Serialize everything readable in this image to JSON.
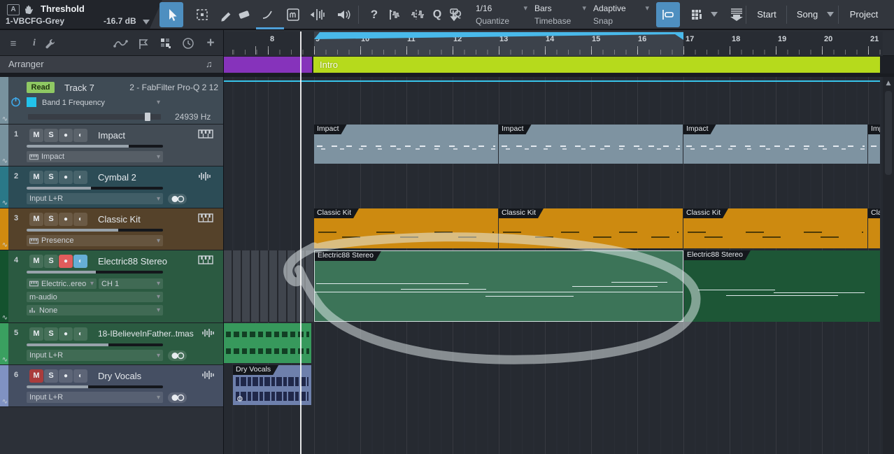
{
  "icons": {
    "chevron": "▾",
    "record": "●",
    "pan": "◐",
    "note": "♫",
    "gear": "⚙",
    "sine": "∿",
    "plus": "+",
    "info": "i",
    "question": "?",
    "menu": "≡",
    "q_tool": "Q",
    "m_tool": "m",
    "a_badge": "A",
    "iq": "IQ",
    "scroll_up": "▲"
  },
  "toolbar": {
    "preset_name": "Threshold",
    "preset_variant": "1-VBCFG-Grey",
    "threshold_value": "-16.7 dB",
    "quantize": {
      "value": "1/16",
      "label": "Quantize"
    },
    "timebase": {
      "value": "Bars",
      "label": "Timebase"
    },
    "snap": {
      "value": "Adaptive",
      "label": "Snap"
    },
    "pages": {
      "start": "Start",
      "song": "Song",
      "project": "Project"
    }
  },
  "panel": {
    "arranger_label": "Arranger"
  },
  "ruler": {
    "bars": [
      "8",
      "9",
      "10",
      "11",
      "12",
      "13",
      "14",
      "15",
      "16",
      "17",
      "18",
      "19",
      "20",
      "21"
    ]
  },
  "arranger": {
    "section_name": "Intro"
  },
  "automation_track": {
    "read_badge": "Read",
    "name": "Track 7",
    "plugin": "2 - FabFilter Pro-Q 2 12",
    "parameter": "Band 1 Frequency",
    "value": "24939 Hz"
  },
  "labels": {
    "mute": "M",
    "solo": "S"
  },
  "tracks": [
    {
      "num": "1",
      "name": "Impact",
      "io": "Impact"
    },
    {
      "num": "2",
      "name": "Cymbal 2",
      "io": "Input L+R"
    },
    {
      "num": "3",
      "name": "Classic Kit",
      "io": "Presence"
    },
    {
      "num": "4",
      "name": "Electric88 Stereo",
      "io": "Electric..ereo",
      "channel": "CH 1",
      "device": "m-audio",
      "insert": "None"
    },
    {
      "num": "5",
      "name": "18-IBelieveInFather..tmas",
      "io": "Input L+R"
    },
    {
      "num": "6",
      "name": "Dry Vocals",
      "io": "Input L+R"
    }
  ],
  "clips": {
    "impact": "Impact",
    "classic_kit": "Classic Kit",
    "electric": "Electric88 Stereo",
    "dry_vocals": "Dry Vocals"
  }
}
